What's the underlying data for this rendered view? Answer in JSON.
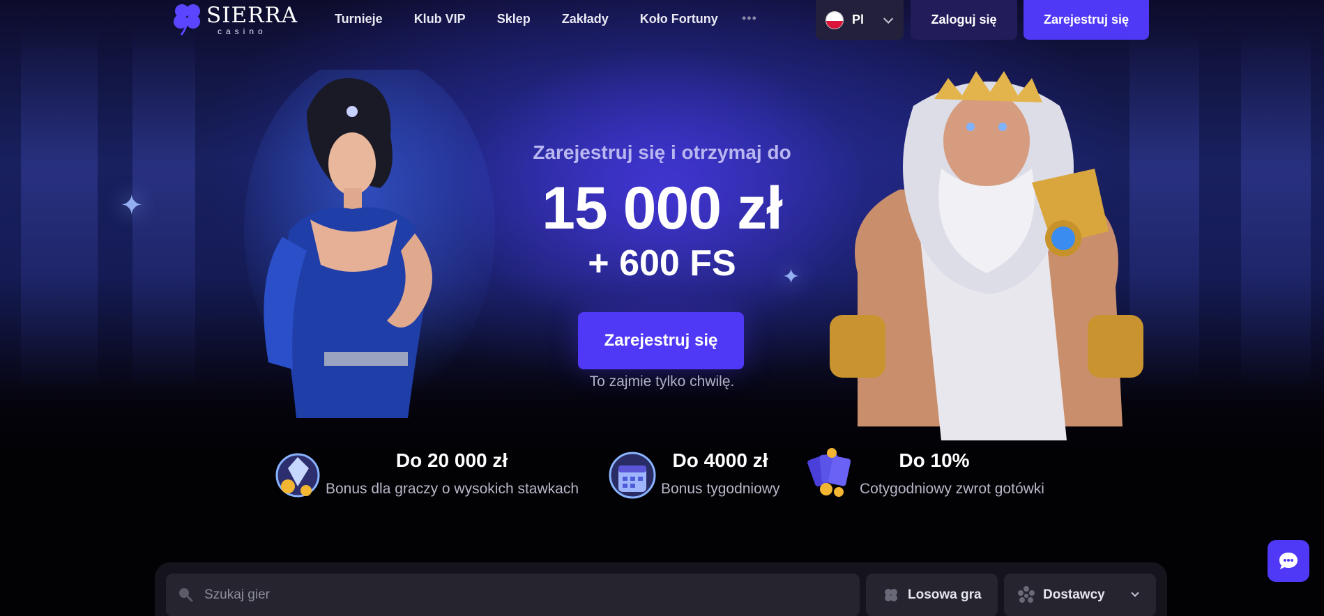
{
  "brand": {
    "name": "SIERRA",
    "sub": "casino",
    "accent": "#4f39f6"
  },
  "nav": {
    "items": [
      {
        "label": "Turnieje"
      },
      {
        "label": "Klub VIP"
      },
      {
        "label": "Sklep"
      },
      {
        "label": "Zakłady"
      },
      {
        "label": "Koło Fortuny"
      }
    ],
    "more_label": "•••"
  },
  "header": {
    "language": {
      "code": "Pl",
      "flag": "poland-flag-icon"
    },
    "login_label": "Zaloguj się",
    "register_label": "Zarejestruj się"
  },
  "hero": {
    "subtitle": "Zarejestruj się i otrzymaj do",
    "amount": "15 000 zł",
    "free_spins": "+ 600 FS",
    "cta_label": "Zarejestruj się",
    "note": "To zajmie tylko chwilę."
  },
  "features": [
    {
      "title": "Do 20 000 zł",
      "desc": "Bonus dla graczy o wysokich stawkach",
      "icon": "diamond-coin-icon"
    },
    {
      "title": "Do 4000 zł",
      "desc": "Bonus tygodniowy",
      "icon": "calendar-icon"
    },
    {
      "title": "Do 10%",
      "desc": "Cotygodniowy zwrot gotówki",
      "icon": "cards-coins-icon"
    }
  ],
  "search": {
    "placeholder": "Szukaj gier",
    "random_label": "Losowa gra",
    "providers_label": "Dostawcy"
  },
  "chat": {
    "icon": "chat-icon"
  }
}
